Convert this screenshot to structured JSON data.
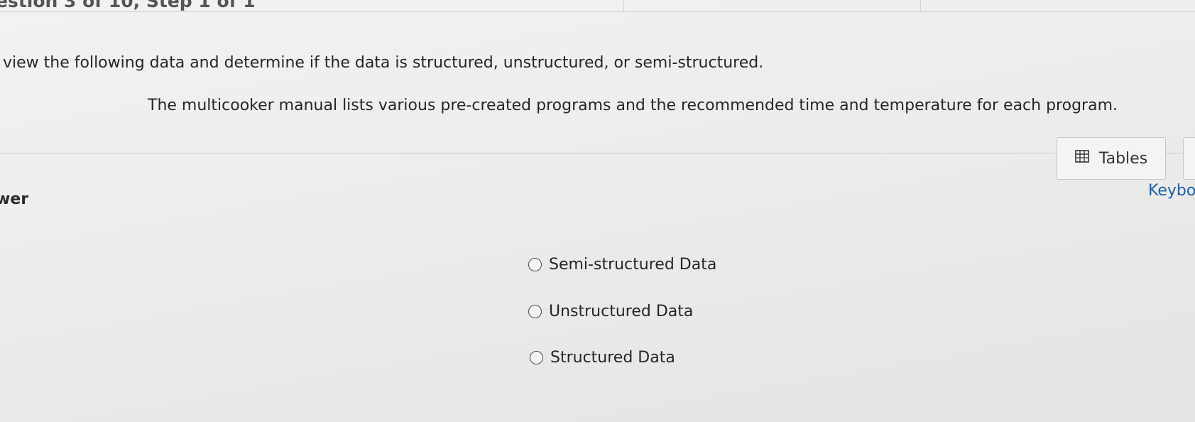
{
  "header": {
    "crumb": "estion 3 of 10, Step 1 of 1"
  },
  "question": {
    "instructions": "view the following data and determine if the data is structured, unstructured, or semi-structured.",
    "text": "The multicooker manual lists various pre-created programs and the recommended time and temperature for each program."
  },
  "answer": {
    "label": "wer",
    "options": [
      {
        "label": "Semi-structured Data"
      },
      {
        "label": "Unstructured Data"
      },
      {
        "label": "Structured Data"
      }
    ]
  },
  "toolbar": {
    "tables_label": "Tables",
    "tables_icon": "table-icon",
    "keyboard_label": "Keybo"
  }
}
